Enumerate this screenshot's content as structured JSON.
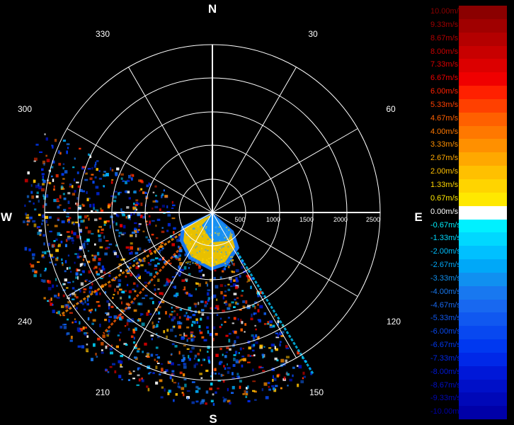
{
  "compass": {
    "north": "N",
    "south": "S",
    "east": "E",
    "west": "W"
  },
  "degree_labels": [
    "330",
    "30",
    "300",
    "60",
    "240",
    "120",
    "210",
    "150"
  ],
  "range_labels": [
    "500",
    "1000",
    "1500",
    "2000",
    "2500"
  ],
  "legend": [
    {
      "label": "10.00m/s",
      "color": "#8b0000"
    },
    {
      "label": "9.33m/s",
      "color": "#a00000"
    },
    {
      "label": "8.67m/s",
      "color": "#b40000"
    },
    {
      "label": "8.00m/s",
      "color": "#c80000"
    },
    {
      "label": "7.33m/s",
      "color": "#dc0000"
    },
    {
      "label": "6.67m/s",
      "color": "#f00000"
    },
    {
      "label": "6.00m/s",
      "color": "#ff2000"
    },
    {
      "label": "5.33m/s",
      "color": "#ff4000"
    },
    {
      "label": "4.67m/s",
      "color": "#ff6000"
    },
    {
      "label": "4.00m/s",
      "color": "#ff7800"
    },
    {
      "label": "3.33m/s",
      "color": "#ff9000"
    },
    {
      "label": "2.67m/s",
      "color": "#ffa800"
    },
    {
      "label": "2.00m/s",
      "color": "#ffc000"
    },
    {
      "label": "1.33m/s",
      "color": "#ffd400"
    },
    {
      "label": "0.67m/s",
      "color": "#ffe800"
    },
    {
      "label": "0.00m/s",
      "color": "#ffffff"
    },
    {
      "label": "-0.67m/s",
      "color": "#00f0ff"
    },
    {
      "label": "-1.33m/s",
      "color": "#00d8ff"
    },
    {
      "label": "-2.00m/s",
      "color": "#00c0ff"
    },
    {
      "label": "-2.67m/s",
      "color": "#00a8f8"
    },
    {
      "label": "-3.33m/s",
      "color": "#1090f0"
    },
    {
      "label": "-4.00m/s",
      "color": "#1878f0"
    },
    {
      "label": "-4.67m/s",
      "color": "#1868f0"
    },
    {
      "label": "-5.33m/s",
      "color": "#1058f0"
    },
    {
      "label": "-6.00m/s",
      "color": "#0848f0"
    },
    {
      "label": "-6.67m/s",
      "color": "#0038f0"
    },
    {
      "label": "-7.33m/s",
      "color": "#0028e8"
    },
    {
      "label": "-8.00m/s",
      "color": "#0018d8"
    },
    {
      "label": "-8.67m/s",
      "color": "#0010c8"
    },
    {
      "label": "-9.33m/s",
      "color": "#0008b8"
    },
    {
      "label": "-10.00m/s",
      "color": "#0000a8"
    }
  ]
}
